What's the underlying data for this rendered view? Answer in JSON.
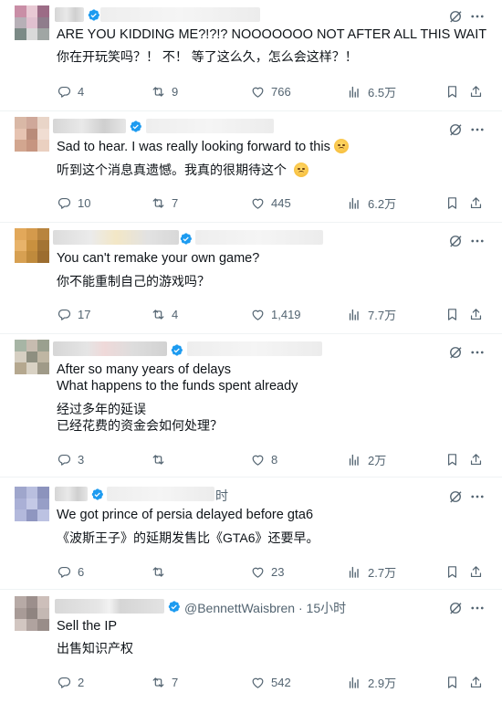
{
  "tweets": [
    {
      "avatar_colors": [
        "#c98ea6",
        "#e8c9d4",
        "#9c6c86",
        "#b7b0b7",
        "#e0c0cf",
        "#8f7d8c",
        "#7b8a86",
        "#d9d9d9",
        "#a0a6a4"
      ],
      "handle_text": "",
      "text_en": [
        "ARE YOU KIDDING ME?!?!? NOOOOOOO NOT AFTER ALL THIS WAIT"
      ],
      "text_zh": [
        "你在开玩笑吗？！ 不！ 等了这么久，怎么会这样？！"
      ],
      "reply": "4",
      "retweet": "9",
      "like": "766",
      "views": "6.5万"
    },
    {
      "avatar_colors": [
        "#d9b8a6",
        "#cfa89a",
        "#e9d5c8",
        "#e6c3b1",
        "#b98c7a",
        "#f0ddd2",
        "#d2a68f",
        "#c69580",
        "#ead0c0"
      ],
      "handle_text": "",
      "text_en": [
        "Sad to hear. I was really looking forward to this"
      ],
      "text_zh": [
        "听到这个消息真遗憾。我真的很期待这个"
      ],
      "reply": "10",
      "retweet": "7",
      "like": "445",
      "views": "6.2万"
    },
    {
      "avatar_colors": [
        "#e2a85a",
        "#d49a4c",
        "#b8843e",
        "#e8b36a",
        "#c9913f",
        "#a37434",
        "#d7a052",
        "#bf8a3c",
        "#9c6d30"
      ],
      "handle_text": "",
      "text_en": [
        "You can't remake your own game?"
      ],
      "text_zh": [
        "你不能重制自己的游戏吗？"
      ],
      "reply": "17",
      "retweet": "4",
      "like": "1,419",
      "views": "7.7万"
    },
    {
      "avatar_colors": [
        "#a7b5a5",
        "#c7bcb0",
        "#9aa08f",
        "#d6cfc2",
        "#8e8f80",
        "#bfb6a3",
        "#b5a88f",
        "#d9d2c4",
        "#9f9a88"
      ],
      "handle_text": "",
      "text_en": [
        "After so many years of delays",
        "What happens to the funds spent already"
      ],
      "text_zh": [
        "经过多年的延误",
        "已经花费的资金会如何处理？"
      ],
      "reply": "3",
      "retweet": "",
      "like": "8",
      "views": "2万"
    },
    {
      "avatar_colors": [
        "#9fa6cc",
        "#b9bfdf",
        "#8c93bd",
        "#aab0d6",
        "#c4c9e6",
        "#979ec7",
        "#b3b9dc",
        "#8f96c0",
        "#bcc2e2"
      ],
      "handle_text": "时",
      "text_en": [
        "We got prince of persia delayed before gta6"
      ],
      "text_zh": [
        "《波斯王子》的延期发售比《GTA6》还要早。"
      ],
      "reply": "6",
      "retweet": "",
      "like": "23",
      "views": "2.7万"
    },
    {
      "avatar_colors": [
        "#b7aaa6",
        "#9c8f8c",
        "#cdbfba",
        "#a89b97",
        "#8f8480",
        "#c4b8b3",
        "#d2c6c1",
        "#b0a39f",
        "#998d89"
      ],
      "handle_text": "@BennettWaisbren · 15小时",
      "text_en": [
        "Sell the IP"
      ],
      "text_zh": [
        "出售知识产权"
      ],
      "reply": "2",
      "retweet": "7",
      "like": "542",
      "views": "2.9万"
    }
  ],
  "icons": {
    "grok": "grok-icon",
    "more": "more-icon",
    "reply": "reply-icon",
    "retweet": "retweet-icon",
    "like": "like-icon",
    "views": "views-icon",
    "bookmark": "bookmark-icon",
    "share": "share-icon",
    "verified": "verified-badge-icon",
    "emoji": "disappointed-face-emoji"
  },
  "colors": {
    "verified": "#1d9bf0",
    "meta": "#536471",
    "text": "#0f1419",
    "divider": "#eff3f4"
  }
}
